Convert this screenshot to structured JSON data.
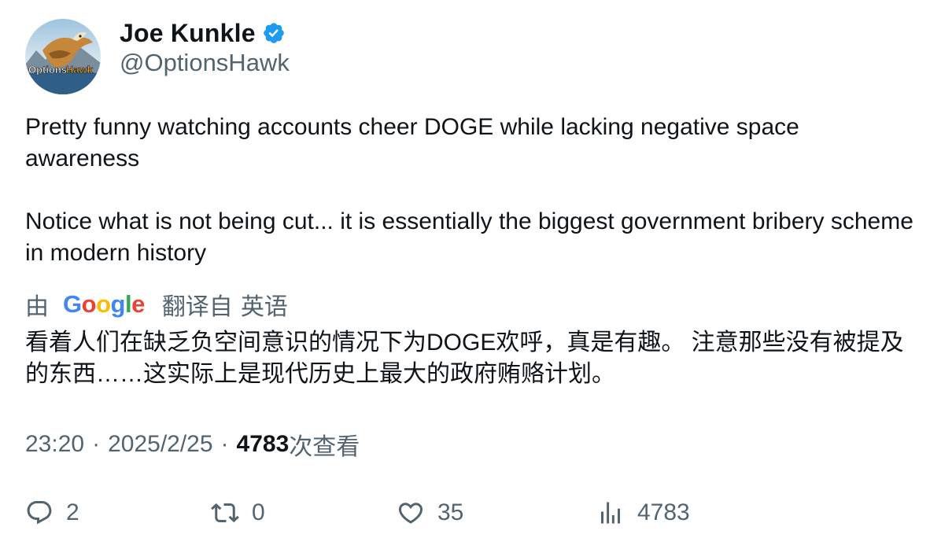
{
  "author": {
    "display_name": "Joe Kunkle",
    "handle": "@OptionsHawk",
    "verified": true,
    "avatar_text": "OptionsHawk"
  },
  "tweet": {
    "paragraphs": [
      "Pretty funny watching accounts cheer DOGE while lacking negative space awareness",
      "Notice what is not being cut... it is essentially the biggest government bribery scheme in modern history"
    ]
  },
  "translation": {
    "by_label": "由",
    "provider": "Google",
    "translated_from_label": "翻译自",
    "source_language": "英语",
    "text": "看着人们在缺乏负空间意识的情况下为DOGE欢呼，真是有趣。 注意那些没有被提及的东西……这实际上是现代历史上最大的政府贿赂计划。"
  },
  "meta": {
    "time": "23:20",
    "separator": "·",
    "date": "2025/2/25",
    "views_count": "4783",
    "views_label": "次查看"
  },
  "actions": {
    "replies": "2",
    "retweets": "0",
    "likes": "35",
    "views": "4783"
  },
  "colors": {
    "text_primary": "#0f1419",
    "text_secondary": "#536471",
    "verified_blue": "#1d9bf0"
  }
}
